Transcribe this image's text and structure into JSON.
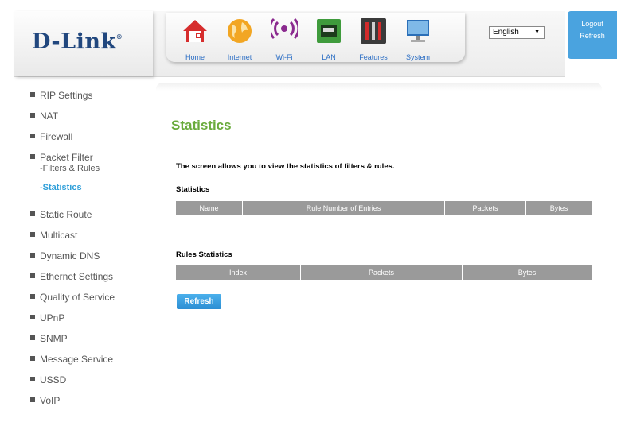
{
  "brand": {
    "logo": "D-Link",
    "reg": "®"
  },
  "nav": [
    {
      "label": "Home",
      "icon": "home-icon"
    },
    {
      "label": "Internet",
      "icon": "globe-icon"
    },
    {
      "label": "Wi-Fi",
      "icon": "wifi-icon"
    },
    {
      "label": "LAN",
      "icon": "lan-port-icon"
    },
    {
      "label": "Features",
      "icon": "tools-icon"
    },
    {
      "label": "System",
      "icon": "monitor-icon"
    }
  ],
  "language": {
    "selected": "English"
  },
  "account": {
    "logout": "Logout",
    "refresh": "Refresh"
  },
  "sidebar": {
    "items": [
      "RIP Settings",
      "NAT",
      "Firewall",
      "Packet Filter"
    ],
    "sub_filters": "-Filters & Rules",
    "sub_active": "-Statistics",
    "items2": [
      "Static Route",
      "Multicast",
      "Dynamic DNS",
      "Ethernet Settings",
      "Quality of Service",
      "UPnP",
      "SNMP",
      "Message Service",
      "USSD",
      "VoIP"
    ]
  },
  "main": {
    "title": "Statistics",
    "description": "The screen allows you to view the statistics of filters & rules.",
    "stats_label": "Statistics",
    "stats_columns": [
      "Name",
      "Rule Number of Entries",
      "Packets",
      "Bytes"
    ],
    "rules_label": "Rules Statistics",
    "rules_columns": [
      "Index",
      "Packets",
      "Bytes"
    ],
    "refresh_button": "Refresh"
  },
  "colors": {
    "accent": "#2f9fd9",
    "title": "#6aab3d",
    "header_cell": "#9a9a9a",
    "logo": "#21477e"
  }
}
